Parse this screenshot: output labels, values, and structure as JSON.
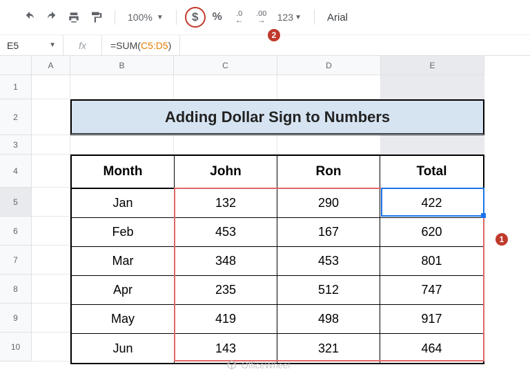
{
  "toolbar": {
    "zoom": "100%",
    "currency": "$",
    "percent": "%",
    "dec_dec": ".0",
    "inc_dec": ".00",
    "more_formats": "123",
    "font": "Arial"
  },
  "formula_bar": {
    "namebox": "E5",
    "fx": "fx",
    "prefix": "=SUM(",
    "ref": "C5:D5",
    "suffix": ")"
  },
  "columns": [
    "A",
    "B",
    "C",
    "D",
    "E"
  ],
  "rows": [
    "1",
    "2",
    "3",
    "4",
    "5",
    "6",
    "7",
    "8",
    "9",
    "10"
  ],
  "title": "Adding Dollar Sign to Numbers",
  "chart_data": {
    "type": "table",
    "headers": [
      "Month",
      "John",
      "Ron",
      "Total"
    ],
    "rows": [
      [
        "Jan",
        132,
        290,
        422
      ],
      [
        "Feb",
        453,
        167,
        620
      ],
      [
        "Mar",
        348,
        453,
        801
      ],
      [
        "Apr",
        235,
        512,
        747
      ],
      [
        "May",
        419,
        498,
        917
      ],
      [
        "Jun",
        143,
        321,
        464
      ]
    ]
  },
  "annotations": {
    "step1": "1",
    "step2": "2"
  },
  "watermark": "OfficeWheel"
}
